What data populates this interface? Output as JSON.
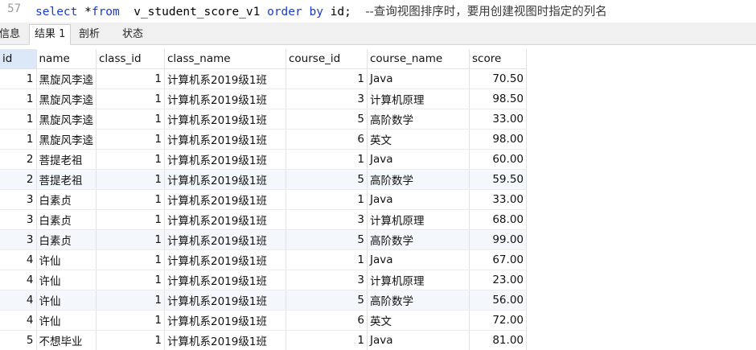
{
  "editor": {
    "line_number": "57",
    "code_tokens": [
      {
        "t": "select ",
        "k": "kw"
      },
      {
        "t": "*",
        "k": "plain"
      },
      {
        "t": "from",
        "k": "kw"
      },
      {
        "t": "  v_student_score_v1 ",
        "k": "plain"
      },
      {
        "t": "order by ",
        "k": "kw"
      },
      {
        "t": "id;  ",
        "k": "plain"
      },
      {
        "t": "--查询视图排序时，要用创建视图时指定的列名",
        "k": "cm"
      }
    ]
  },
  "tabs": [
    {
      "label": "信息",
      "active": false
    },
    {
      "label": "结果 1",
      "active": true
    },
    {
      "label": "剖析",
      "active": false
    },
    {
      "label": "状态",
      "active": false
    }
  ],
  "grid": {
    "columns": [
      {
        "key": "id",
        "label": "id",
        "align": "num",
        "sorted": true
      },
      {
        "key": "name",
        "label": "name",
        "align": "txt",
        "sorted": false
      },
      {
        "key": "class_id",
        "label": "class_id",
        "align": "num",
        "sorted": false
      },
      {
        "key": "class_name",
        "label": "class_name",
        "align": "txt",
        "sorted": false
      },
      {
        "key": "course_id",
        "label": "course_id",
        "align": "num",
        "sorted": false
      },
      {
        "key": "course_name",
        "label": "course_name",
        "align": "txt",
        "sorted": false
      },
      {
        "key": "score",
        "label": "score",
        "align": "num",
        "sorted": false
      }
    ],
    "rows": [
      [
        "1",
        "黑旋风李逵",
        "1",
        "计算机系2019级1班",
        "1",
        "Java",
        "70.50"
      ],
      [
        "1",
        "黑旋风李逵",
        "1",
        "计算机系2019级1班",
        "3",
        "计算机原理",
        "98.50"
      ],
      [
        "1",
        "黑旋风李逵",
        "1",
        "计算机系2019级1班",
        "5",
        "高阶数学",
        "33.00"
      ],
      [
        "1",
        "黑旋风李逵",
        "1",
        "计算机系2019级1班",
        "6",
        "英文",
        "98.00"
      ],
      [
        "2",
        "菩提老祖",
        "1",
        "计算机系2019级1班",
        "1",
        "Java",
        "60.00"
      ],
      [
        "2",
        "菩提老祖",
        "1",
        "计算机系2019级1班",
        "5",
        "高阶数学",
        "59.50"
      ],
      [
        "3",
        "白素贞",
        "1",
        "计算机系2019级1班",
        "1",
        "Java",
        "33.00"
      ],
      [
        "3",
        "白素贞",
        "1",
        "计算机系2019级1班",
        "3",
        "计算机原理",
        "68.00"
      ],
      [
        "3",
        "白素贞",
        "1",
        "计算机系2019级1班",
        "5",
        "高阶数学",
        "99.00"
      ],
      [
        "4",
        "许仙",
        "1",
        "计算机系2019级1班",
        "1",
        "Java",
        "67.00"
      ],
      [
        "4",
        "许仙",
        "1",
        "计算机系2019级1班",
        "3",
        "计算机原理",
        "23.00"
      ],
      [
        "4",
        "许仙",
        "1",
        "计算机系2019级1班",
        "5",
        "高阶数学",
        "56.00"
      ],
      [
        "4",
        "许仙",
        "1",
        "计算机系2019级1班",
        "6",
        "英文",
        "72.00"
      ],
      [
        "5",
        "不想毕业",
        "1",
        "计算机系2019级1班",
        "1",
        "Java",
        "81.00"
      ]
    ],
    "highlighted_rows": [
      5,
      8,
      11
    ]
  }
}
